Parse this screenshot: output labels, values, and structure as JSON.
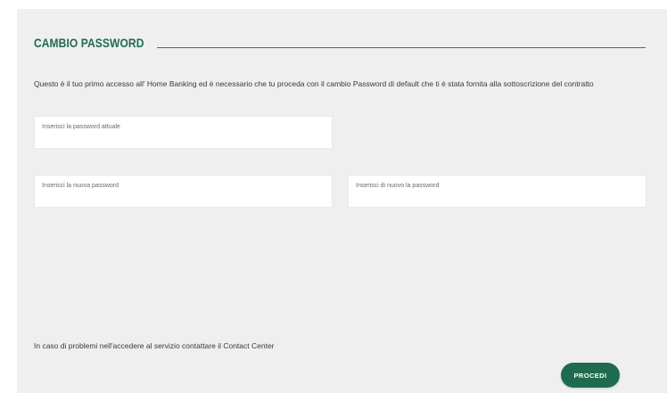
{
  "form": {
    "title": "CAMBIO PASSWORD",
    "intro": "Questo è il tuo primo accesso all' Home Banking ed è necessario che tu proceda con il cambio Password di default che ti è stata fornita alla sottoscrizione del contratto",
    "fields": [
      {
        "placeholder": "Inserisci la password attuale",
        "value": ""
      },
      {
        "placeholder": "Inserisci la nuova password",
        "value": ""
      },
      {
        "placeholder": "Inserisci di nuovo la password",
        "value": ""
      }
    ],
    "help_text": "In caso di problemi nell'accedere al servizio contattare il Contact Center",
    "submit_label": "PROCEDI"
  },
  "colors": {
    "accent": "#1f6b4f",
    "panel_background": "#efeff0",
    "field_background": "#ffffff"
  }
}
